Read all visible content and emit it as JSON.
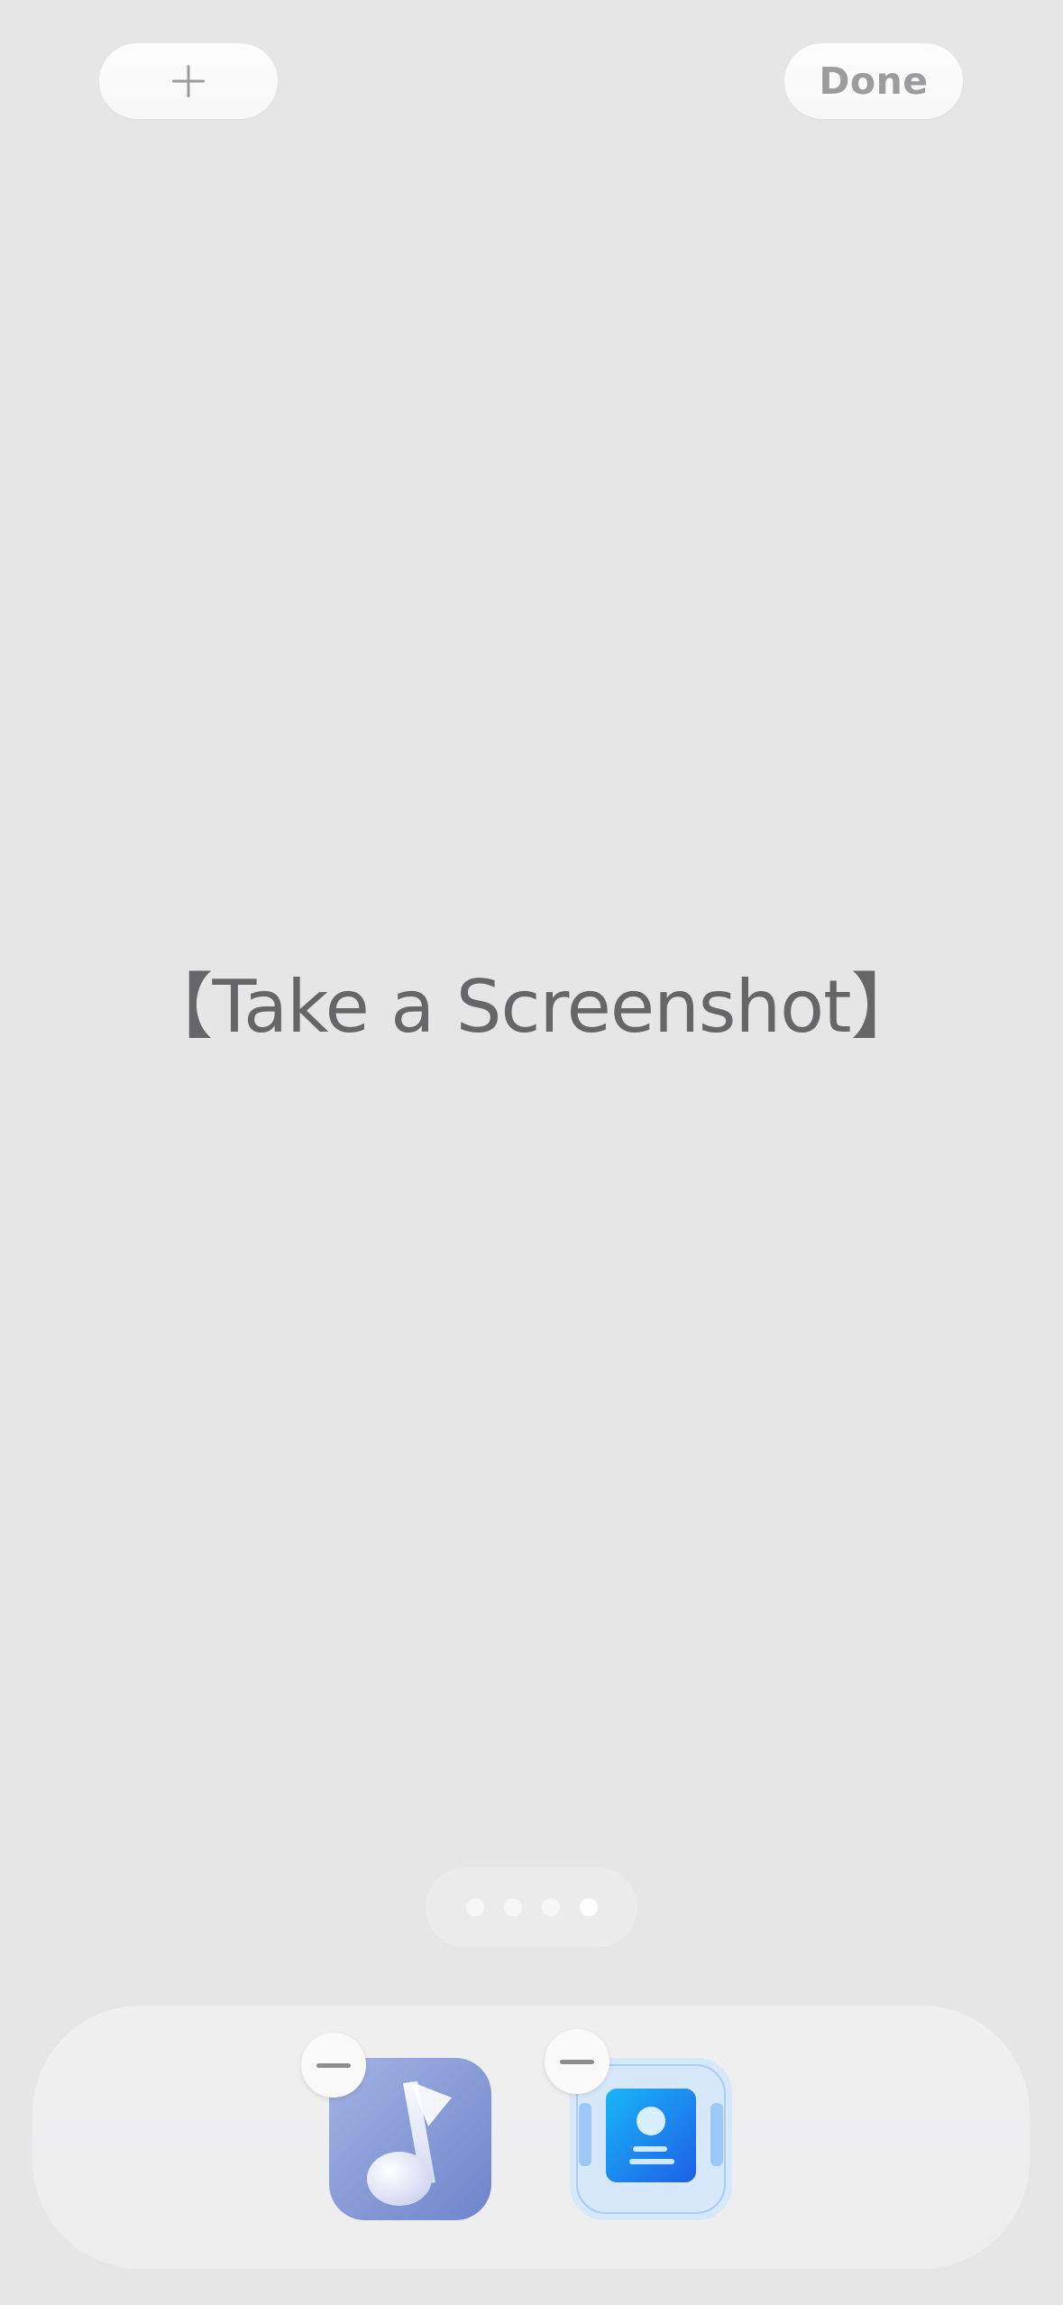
{
  "header": {
    "add_button": {
      "icon": "plus-icon"
    },
    "done_label": "Done"
  },
  "placeholder": {
    "text": "【Take a Screenshot】"
  },
  "page_indicator": {
    "page_count": 4,
    "current_page": 4
  },
  "dock": {
    "apps": [
      {
        "icon": "music-app-icon",
        "remove_icon": "minus-icon"
      },
      {
        "icon": "contacts-app-icon",
        "remove_icon": "minus-icon"
      }
    ]
  },
  "colors": {
    "background": "#e6e6e7",
    "button_text": "#9c9c9e",
    "placeholder_text": "#666668",
    "music_icon": "#7b8fd0",
    "contacts_icon": "#1a86f5"
  }
}
